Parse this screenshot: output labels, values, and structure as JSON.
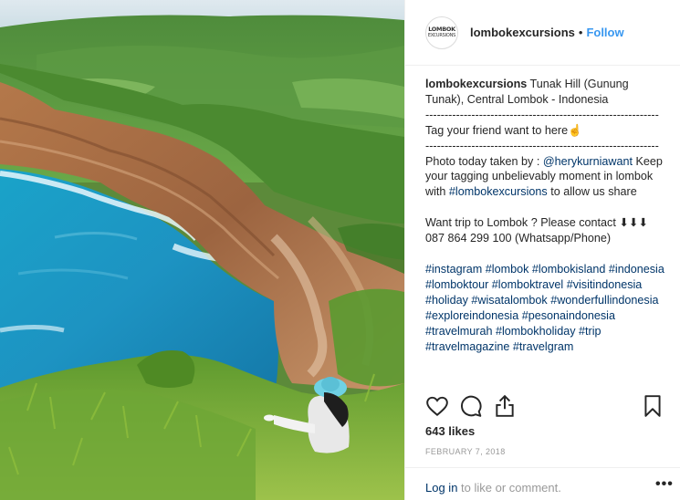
{
  "post": {
    "username": "lombokexcursions",
    "follow_label": "Follow",
    "dot": "•",
    "avatar_text_line1": "LOMBOK",
    "avatar_text_line2": "EXCURSIONS",
    "photo_alt": "Tunak Hill coastline"
  },
  "caption": {
    "username": "lombokexcursions",
    "lines": [
      " Tunak Hill (Gunung Tunak), Central Lombok - Indonesia ",
      "-------------------------------------------------------------",
      "Tag your friend want to here☝",
      "-------------------------------------------------------------",
      " Photo today taken by : ",
      "@herykurniawant",
      " Keep your tagging unbelievably moment in lombok with ",
      "#lombokexcursions",
      " to allow us share",
      "Want trip to Lombok ? Please contact ⬇⬇⬇ 087 864 299 100 (Whatsapp/Phone)",
      "#instagram #lombok #lombokisland #indonesia #lomboktour #lomboktravel #visitindonesia #holiday #wisatalombok #wonderfullindonesia #exploreindonesia #pesonaindonesia #travelmurah #lombokholiday #trip #travelmagazine #travelgram"
    ]
  },
  "stats": {
    "likes": "643 likes",
    "date": "FEBRUARY 7, 2018"
  },
  "footer": {
    "login_link": "Log in",
    "login_rest": " to like or comment.",
    "more": "•••"
  },
  "icons": {
    "like": "heart-icon",
    "comment": "comment-icon",
    "share": "share-icon",
    "save": "bookmark-icon"
  },
  "colors": {
    "link_blue": "#3897f0",
    "hashtag": "#003569",
    "muted": "#999999",
    "border": "#efefef"
  }
}
